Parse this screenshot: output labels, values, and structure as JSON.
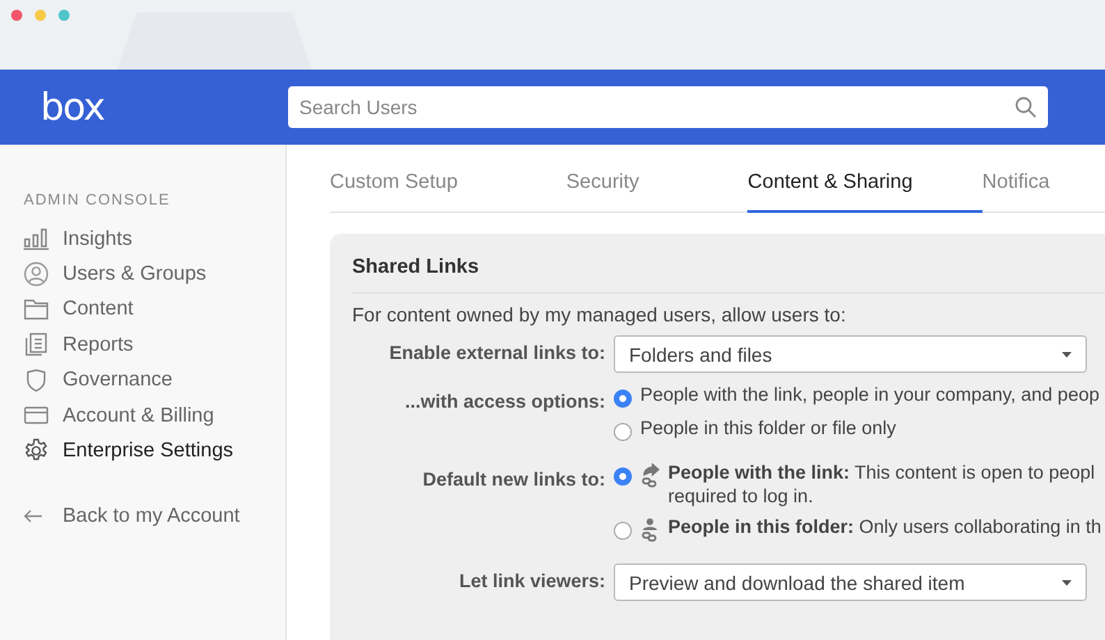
{
  "header": {
    "logo": "box",
    "search": {
      "placeholder": "Search Users"
    }
  },
  "sidebar": {
    "heading": "ADMIN CONSOLE",
    "items": [
      {
        "label": "Insights",
        "selected": false
      },
      {
        "label": "Users & Groups",
        "selected": false
      },
      {
        "label": "Content",
        "selected": false
      },
      {
        "label": "Reports",
        "selected": false
      },
      {
        "label": "Governance",
        "selected": false
      },
      {
        "label": "Account & Billing",
        "selected": false
      },
      {
        "label": "Enterprise Settings",
        "selected": true
      }
    ],
    "back": "Back to my Account"
  },
  "tabs": [
    {
      "label": "Custom Setup",
      "selected": false
    },
    {
      "label": "Security",
      "selected": false
    },
    {
      "label": "Content & Sharing",
      "selected": true
    },
    {
      "label": "Notifica",
      "selected": false
    }
  ],
  "section": {
    "title": "Shared Links",
    "intro": "For content owned by my managed users, allow users to:",
    "rows": [
      {
        "kind": "select",
        "label": "Enable external links to:",
        "value": "Folders and files"
      },
      {
        "kind": "radio",
        "label": "...with access options:",
        "options": [
          {
            "text": "People with the link, people in your company, and peop",
            "selected": true
          },
          {
            "text": "People in this folder or file only",
            "selected": false
          }
        ]
      },
      {
        "kind": "radio",
        "label": "Default new links to:",
        "options": [
          {
            "text": "**People with the link:**  This content is open to peopl",
            "subtext": "required to log in.",
            "selected": true
          },
          {
            "text": "**People in this folder:** Only users collaborating in th",
            "selected": false
          }
        ]
      },
      {
        "kind": "select",
        "label": "Let link viewers:",
        "value": "Preview and download the shared item"
      }
    ]
  }
}
